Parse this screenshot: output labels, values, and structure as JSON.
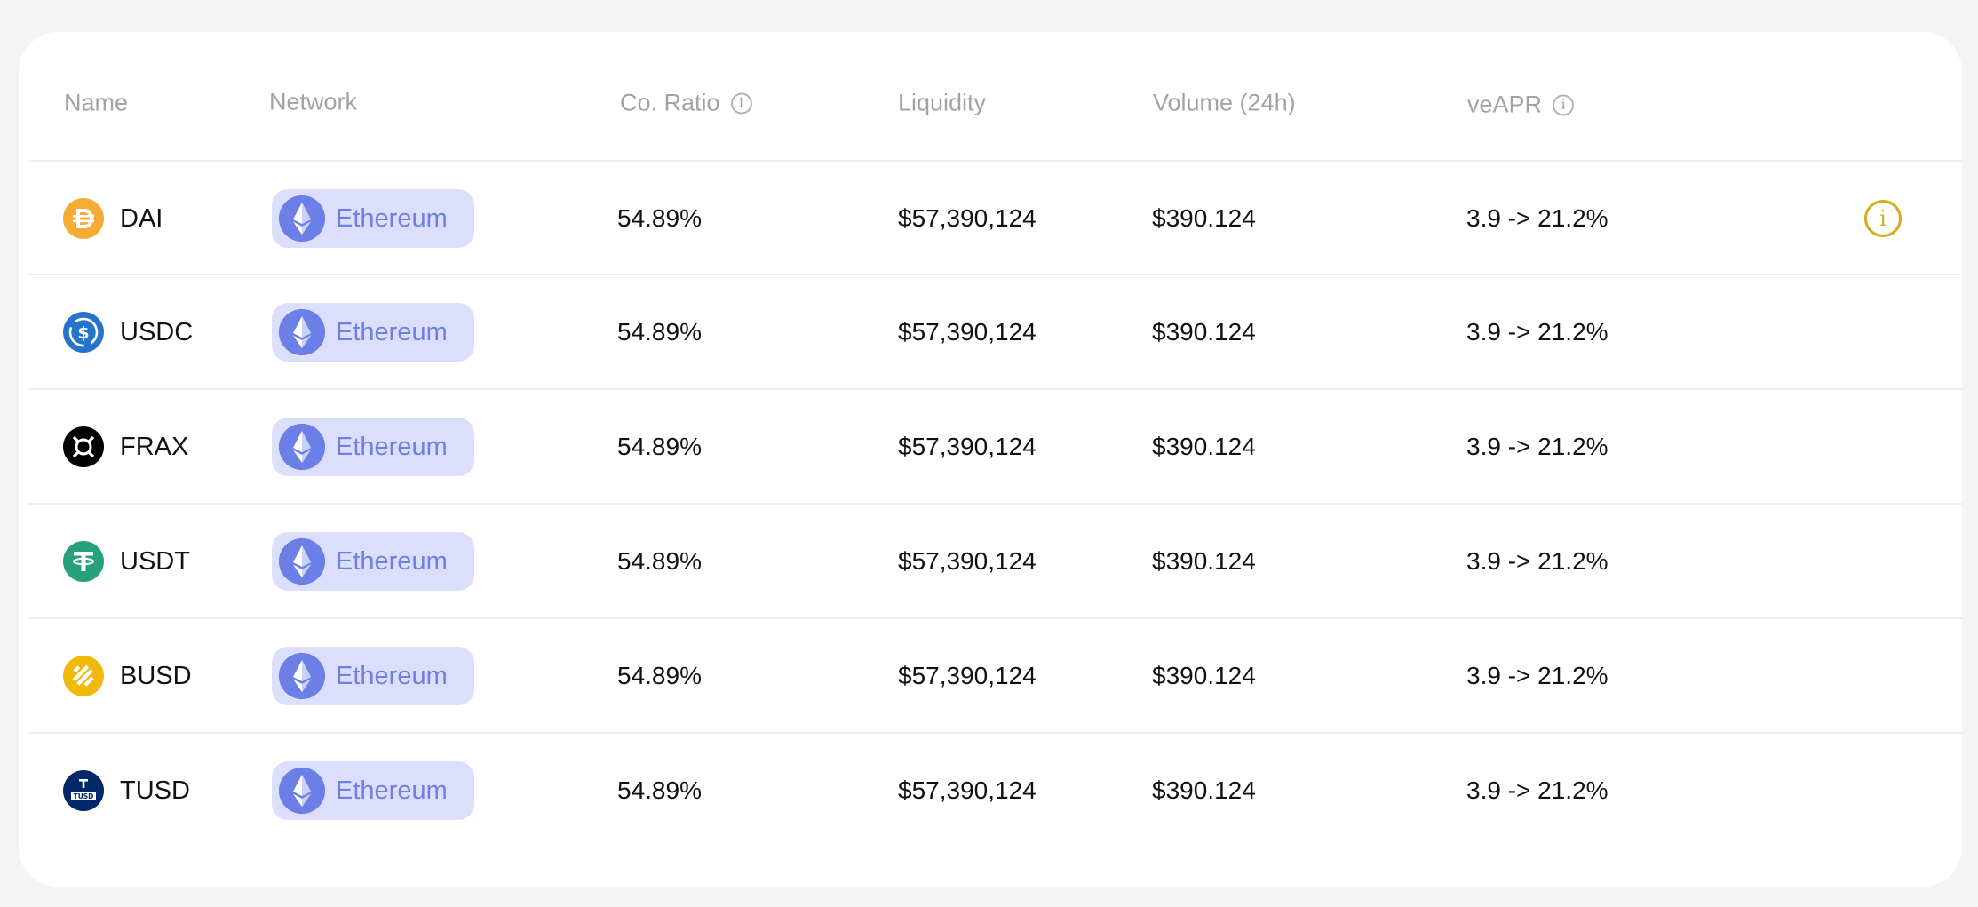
{
  "table": {
    "columns": {
      "name": "Name",
      "network": "Network",
      "co_ratio": "Co. Ratio",
      "liquidity": "Liquidity",
      "volume": "Volume (24h)",
      "veapr": "veAPR"
    },
    "info_glyph": "i",
    "rows": [
      {
        "token": "DAI",
        "icon": "dai-icon",
        "network": "Ethereum",
        "co_ratio": "54.89%",
        "liquidity": "$57,390,124",
        "volume": "$390.124",
        "veapr": "3.9 -> 21.2%"
      },
      {
        "token": "USDC",
        "icon": "usdc-icon",
        "network": "Ethereum",
        "co_ratio": "54.89%",
        "liquidity": "$57,390,124",
        "volume": "$390.124",
        "veapr": "3.9 -> 21.2%"
      },
      {
        "token": "FRAX",
        "icon": "frax-icon",
        "network": "Ethereum",
        "co_ratio": "54.89%",
        "liquidity": "$57,390,124",
        "volume": "$390.124",
        "veapr": "3.9 -> 21.2%"
      },
      {
        "token": "USDT",
        "icon": "usdt-icon",
        "network": "Ethereum",
        "co_ratio": "54.89%",
        "liquidity": "$57,390,124",
        "volume": "$390.124",
        "veapr": "3.9 -> 21.2%"
      },
      {
        "token": "BUSD",
        "icon": "busd-icon",
        "network": "Ethereum",
        "co_ratio": "54.89%",
        "liquidity": "$57,390,124",
        "volume": "$390.124",
        "veapr": "3.9 -> 21.2%"
      },
      {
        "token": "TUSD",
        "icon": "tusd-icon",
        "network": "Ethereum",
        "co_ratio": "54.89%",
        "liquidity": "$57,390,124",
        "volume": "$390.124",
        "veapr": "3.9 -> 21.2%"
      }
    ],
    "tusd_icon_text": "TUSD"
  },
  "colors": {
    "dai": "#f5ac37",
    "usdc": "#2775ca",
    "frax": "#000000",
    "usdt": "#26a17b",
    "busd": "#f0b90b",
    "tusd": "#002868",
    "network_pill": "#dcdffc",
    "network_text": "#6f80e0",
    "eth_icon": "#6b7fe6",
    "info_accent": "#d8ac16"
  }
}
